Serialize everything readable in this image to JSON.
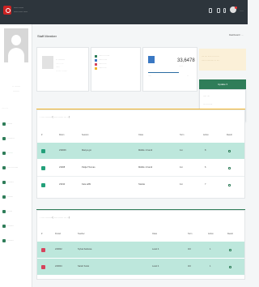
{
  "header": {
    "brand_line1": "···········",
    "brand_line2": "·········· ·····",
    "user_label": "·····"
  },
  "sidebar": {
    "profile_name": "·· ·······",
    "profile_sub": "········",
    "nav_title": "··········",
    "items": [
      {
        "label": "·······",
        "active": false
      },
      {
        "label": "··········",
        "active": false
      },
      {
        "label": "········",
        "active": true
      },
      {
        "label": "···· ··········",
        "active": false
      },
      {
        "label": "·········",
        "active": false
      },
      {
        "label": "········",
        "active": false
      },
      {
        "label": "·······",
        "active": false
      },
      {
        "label": "·········",
        "active": false
      },
      {
        "label": "·········",
        "active": false
      }
    ]
  },
  "page": {
    "title": "Staff Member",
    "breadcrumb": "Dashboard / ···"
  },
  "profile_card": {
    "name": "·· ········",
    "lines": [
      "······ ·····",
      "······",
      "··· ···· · ·······"
    ]
  },
  "legend_card": {
    "items": [
      {
        "label": "······ ···· ·····",
        "color": "#2f7d59"
      },
      {
        "label": "······· ·····",
        "color": "#3a78c3"
      },
      {
        "label": "······ ·····",
        "color": "#d6435c"
      },
      {
        "label": "······ ·····",
        "color": "#f0b429"
      }
    ]
  },
  "stat_card": {
    "number": "33,6478",
    "sub": "·······",
    "left": "·····",
    "right": "··"
  },
  "alert": {
    "line1": "···· ···· ······ ··· ··· ···",
    "line2": "······· ··········· ··· ····",
    "color": "#fbf0d8"
  },
  "actions": {
    "button": "Update ▾",
    "dropdown": [
      "····· ····",
      "··· ···· ·····",
      "······· ········"
    ]
  },
  "table1": {
    "title": "· ···· ········ (······ ······ ··· ··)",
    "headers": [
      "#",
      "Room",
      "Session",
      "Class",
      "Term",
      "Action",
      "Result"
    ],
    "rows": [
      {
        "code": "230006",
        "name": "Mariya gsi",
        "class": "Middle 1 Fandi",
        "term": "1st",
        "count": "8"
      },
      {
        "code": "23008",
        "name": "Patija Thomas",
        "class": "Middle 1 Fandi",
        "term": "1st",
        "count": "6"
      },
      {
        "code": "23010",
        "name": "Kate ai89",
        "class": "Stanite",
        "term": "1st",
        "count": "7"
      }
    ]
  },
  "table2": {
    "title": "· ···· ········ (······ ······ ··· ··)",
    "headers": [
      "#",
      "Period",
      "Teacher",
      "Class",
      "Term",
      "Action",
      "Result"
    ],
    "rows": [
      {
        "code": "220002",
        "name": "Sylvia Sekiswa",
        "class": "Level 4",
        "term": "3rd",
        "count": "1"
      },
      {
        "code": "220004",
        "name": "Sarah Sukui",
        "class": "Level 4",
        "term": "3rd",
        "count": "1"
      }
    ]
  },
  "colors": {
    "topbar": "#2d353c",
    "accent_green": "#2f7d59",
    "row_highlight": "#bde7dc",
    "badge_green": "#23a07a",
    "badge_red": "#d6435c",
    "blue": "#3a78c3"
  }
}
